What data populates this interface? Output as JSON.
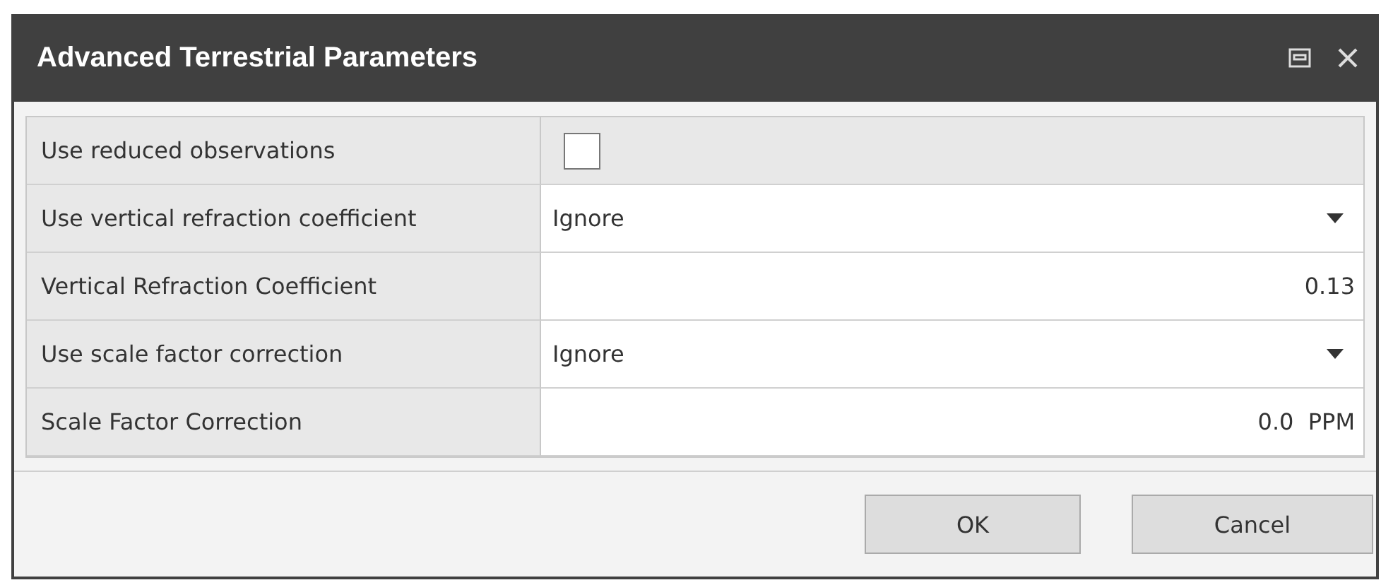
{
  "window": {
    "title": "Advanced Terrestrial Parameters"
  },
  "rows": [
    {
      "label": "Use reduced observations",
      "kind": "checkbox",
      "checked": false
    },
    {
      "label": "Use vertical refraction coefficient",
      "kind": "dropdown",
      "value": "Ignore"
    },
    {
      "label": "Vertical Refraction Coefficient",
      "kind": "number",
      "value": "0.13"
    },
    {
      "label": "Use scale factor correction",
      "kind": "dropdown",
      "value": "Ignore"
    },
    {
      "label": "Scale Factor Correction",
      "kind": "number",
      "value": "0.0  PPM"
    }
  ],
  "buttons": [
    "OK",
    "Cancel"
  ]
}
